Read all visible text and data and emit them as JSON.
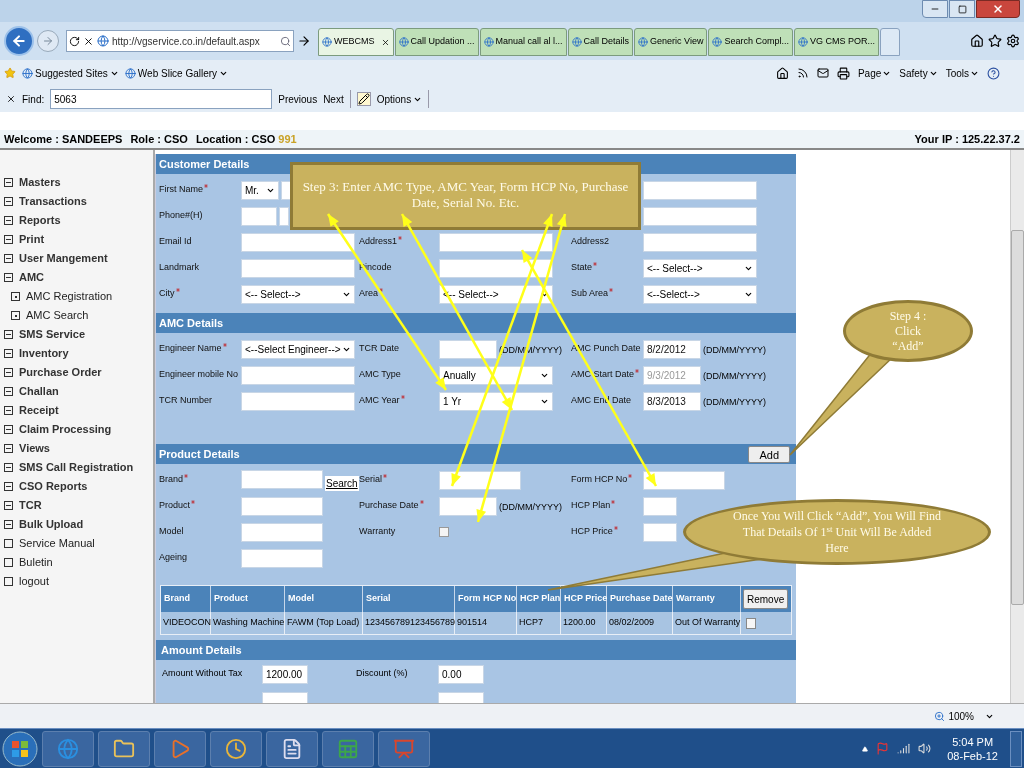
{
  "browser": {
    "address": "http://vgservice.co.in/default.aspx",
    "tabs": [
      {
        "label": "WEBCMS",
        "selected": true
      },
      {
        "label": "Call Updation ...",
        "selected": false
      },
      {
        "label": "Manual call al l...",
        "selected": false
      },
      {
        "label": "Call Details",
        "selected": false
      },
      {
        "label": "Generic View",
        "selected": false
      },
      {
        "label": "Search Compl...",
        "selected": false
      },
      {
        "label": "VG CMS POR...",
        "selected": false
      }
    ],
    "favorites": [
      "Suggested Sites",
      "Web Slice Gallery"
    ],
    "commands": [
      "Page",
      "Safety",
      "Tools"
    ],
    "find": {
      "label": "Find:",
      "value": "5063",
      "previous": "Previous",
      "next": "Next",
      "options": "Options"
    }
  },
  "header": {
    "welcome_label": "Welcome :",
    "user": "SANDEEPS",
    "role_label": "Role :",
    "role": "CSO",
    "location_label": "Location :",
    "location": "CSO",
    "location_code": "991",
    "ip_label": "Your IP :",
    "ip": "125.22.37.2"
  },
  "sidebar": {
    "items": [
      {
        "label": "Masters",
        "kind": "group"
      },
      {
        "label": "Transactions",
        "kind": "group"
      },
      {
        "label": "Reports",
        "kind": "group"
      },
      {
        "label": "Print",
        "kind": "group"
      },
      {
        "label": "User Mangement",
        "kind": "group"
      },
      {
        "label": "AMC",
        "kind": "group",
        "children": [
          {
            "label": "AMC Registration",
            "kind": "sub"
          },
          {
            "label": "AMC Search",
            "kind": "sub"
          }
        ]
      },
      {
        "label": "SMS Service",
        "kind": "group"
      },
      {
        "label": "Inventory",
        "kind": "group"
      },
      {
        "label": "Purchase Order",
        "kind": "group"
      },
      {
        "label": "Challan",
        "kind": "group"
      },
      {
        "label": "Receipt",
        "kind": "group"
      },
      {
        "label": "Claim Processing",
        "kind": "group"
      },
      {
        "label": "Views",
        "kind": "group"
      },
      {
        "label": "SMS Call Registration",
        "kind": "group"
      },
      {
        "label": "CSO Reports",
        "kind": "group"
      },
      {
        "label": "TCR",
        "kind": "group"
      },
      {
        "label": "Bulk Upload",
        "kind": "group"
      },
      {
        "label": "Service Manual",
        "kind": "link"
      },
      {
        "label": "Buletin",
        "kind": "link"
      },
      {
        "label": "logout",
        "kind": "link"
      }
    ]
  },
  "customer": {
    "title": "Customer Details",
    "rows": [
      [
        {
          "kind": "field",
          "label": "First Name",
          "required": true,
          "controls": [
            {
              "kind": "small_select",
              "value": "Mr."
            },
            {
              "kind": "stub_input"
            }
          ]
        },
        {
          "kind": "blank"
        },
        {
          "kind": "field",
          "controls": [
            {
              "kind": "input"
            }
          ]
        }
      ],
      [
        {
          "kind": "field",
          "label": "Phone#(H)",
          "required": false,
          "controls": [
            {
              "kind": "narrow_input"
            },
            {
              "kind": "stub_input"
            }
          ]
        },
        {
          "kind": "blank"
        },
        {
          "kind": "field",
          "controls": [
            {
              "kind": "input"
            }
          ]
        }
      ],
      [
        {
          "kind": "field",
          "label": "Email Id",
          "required": false,
          "controls": [
            {
              "kind": "input"
            }
          ]
        },
        {
          "kind": "field",
          "label": "Address1",
          "required": true,
          "controls": [
            {
              "kind": "input"
            }
          ]
        },
        {
          "kind": "field",
          "label": "Address2",
          "required": false,
          "controls": [
            {
              "kind": "input"
            }
          ]
        }
      ],
      [
        {
          "kind": "field",
          "label": "Landmark",
          "required": false,
          "controls": [
            {
              "kind": "input"
            }
          ]
        },
        {
          "kind": "field",
          "label": "Pincode",
          "required": false,
          "controls": [
            {
              "kind": "input"
            }
          ]
        },
        {
          "kind": "field",
          "label": "State",
          "required": true,
          "controls": [
            {
              "kind": "select",
              "value": "<-- Select-->"
            }
          ]
        }
      ],
      [
        {
          "kind": "field",
          "label": "City",
          "required": true,
          "controls": [
            {
              "kind": "select",
              "value": "<-- Select-->"
            }
          ]
        },
        {
          "kind": "field",
          "label": "Area",
          "required": true,
          "controls": [
            {
              "kind": "select",
              "value": "<-- Select-->"
            }
          ]
        },
        {
          "kind": "field",
          "label": "Sub Area",
          "required": true,
          "controls": [
            {
              "kind": "select",
              "value": "<--Select-->"
            }
          ]
        }
      ]
    ]
  },
  "amc": {
    "title": "AMC Details",
    "rows": [
      [
        {
          "kind": "field",
          "label": "Engineer Name",
          "required": true,
          "controls": [
            {
              "kind": "select",
              "value": "<--Select Engineer-->"
            }
          ]
        },
        {
          "kind": "field",
          "label": "TCR Date",
          "required": false,
          "controls": [
            {
              "kind": "date_input"
            },
            {
              "kind": "hint",
              "value": "(DD/MM/YYYY)"
            }
          ]
        },
        {
          "kind": "field",
          "label": "AMC Punch Date",
          "required": false,
          "controls": [
            {
              "kind": "date_input",
              "value": "8/2/2012"
            },
            {
              "kind": "hint",
              "value": "(DD/MM/YYYY)"
            }
          ]
        }
      ],
      [
        {
          "kind": "field",
          "label": "Engineer mobile No",
          "required": false,
          "controls": [
            {
              "kind": "input"
            }
          ]
        },
        {
          "kind": "field",
          "label": "AMC Type",
          "required": false,
          "controls": [
            {
              "kind": "select",
              "value": "Anually"
            }
          ]
        },
        {
          "kind": "field",
          "label": "AMC Start Date",
          "required": true,
          "controls": [
            {
              "kind": "date_input",
              "value": "9/3/2012",
              "disabled": true
            },
            {
              "kind": "hint",
              "value": "(DD/MM/YYYY)"
            }
          ]
        }
      ],
      [
        {
          "kind": "field",
          "label": "TCR Number",
          "required": false,
          "controls": [
            {
              "kind": "input"
            }
          ]
        },
        {
          "kind": "field",
          "label": "AMC Year",
          "required": true,
          "controls": [
            {
              "kind": "select",
              "value": "1 Yr"
            }
          ]
        },
        {
          "kind": "field",
          "label": "AMC End Date",
          "required": false,
          "controls": [
            {
              "kind": "date_input",
              "value": "8/3/2013"
            },
            {
              "kind": "hint",
              "value": "(DD/MM/YYYY)"
            }
          ]
        }
      ]
    ]
  },
  "product": {
    "title": "Product Details",
    "action": "Add",
    "rows": [
      [
        {
          "kind": "field",
          "label": "Brand",
          "required": true,
          "controls": [
            {
              "kind": "short_input"
            },
            {
              "kind": "link",
              "value": "Search"
            }
          ]
        },
        {
          "kind": "field",
          "label": "Serial",
          "required": true,
          "controls": [
            {
              "kind": "short_input"
            }
          ]
        },
        {
          "kind": "field",
          "label": "Form HCP No",
          "required": true,
          "controls": [
            {
              "kind": "short_input"
            }
          ]
        }
      ],
      [
        {
          "kind": "field",
          "label": "Product",
          "required": true,
          "controls": [
            {
              "kind": "short_input"
            }
          ]
        },
        {
          "kind": "field",
          "label": "Purchase Date",
          "required": true,
          "controls": [
            {
              "kind": "date_input"
            },
            {
              "kind": "hint",
              "value": "(DD/MM/YYYY)"
            }
          ]
        },
        {
          "kind": "field",
          "label": "HCP Plan",
          "required": true,
          "controls": [
            {
              "kind": "partial_input"
            }
          ]
        }
      ],
      [
        {
          "kind": "field",
          "label": "Model",
          "required": false,
          "controls": [
            {
              "kind": "short_input"
            }
          ]
        },
        {
          "kind": "field",
          "label": "Warranty",
          "required": false,
          "controls": [
            {
              "kind": "checkbox",
              "checked": false
            }
          ]
        },
        {
          "kind": "field",
          "label": "HCP Price",
          "required": true,
          "controls": [
            {
              "kind": "partial_input"
            }
          ]
        }
      ],
      [
        {
          "kind": "field",
          "label": "Ageing",
          "required": false,
          "controls": [
            {
              "kind": "short_input"
            }
          ]
        }
      ]
    ],
    "table": {
      "columns": [
        "Brand",
        "Product",
        "Model",
        "Serial",
        "Form HCP No",
        "HCP Plan",
        "HCP Price",
        "Purchase Date",
        "Warranty"
      ],
      "remove": "Remove",
      "rows": [
        {
          "cells": [
            "VIDEOCON",
            "Washing Machine",
            "FAWM (Top Load)",
            "123456789123456789",
            "901514",
            "HCP7",
            "1200.00",
            "08/02/2009",
            "Out Of Warranty"
          ],
          "checked": false
        }
      ]
    }
  },
  "amount": {
    "title": "Amount Details",
    "rows": [
      [
        {
          "kind": "field",
          "label": "Amount Without Tax",
          "controls": [
            {
              "kind": "amount_input",
              "value": "1200.00"
            }
          ]
        },
        {
          "kind": "field",
          "label": "Discount (%)",
          "controls": [
            {
              "kind": "amount_input",
              "value": "0.00"
            }
          ]
        }
      ],
      [
        {
          "kind": "field",
          "controls": [
            {
              "kind": "amount_input"
            }
          ]
        },
        {
          "kind": "field",
          "controls": [
            {
              "kind": "amount_input"
            }
          ]
        }
      ]
    ]
  },
  "status": {
    "zoom": "100%"
  },
  "taskbar": {
    "time": "5:04 PM",
    "date": "08-Feb-12"
  },
  "annotations": {
    "step3": "Step 3: Enter AMC Type, AMC Year, Form HCP No, Purchase Date, Serial No. Etc.",
    "step4": [
      "Step 4 :",
      "Click",
      "“Add”"
    ],
    "result": "Once You Will Click “Add”, You Will Find That Details Of 1$^{st}$ Unit Will Be Added Here"
  }
}
